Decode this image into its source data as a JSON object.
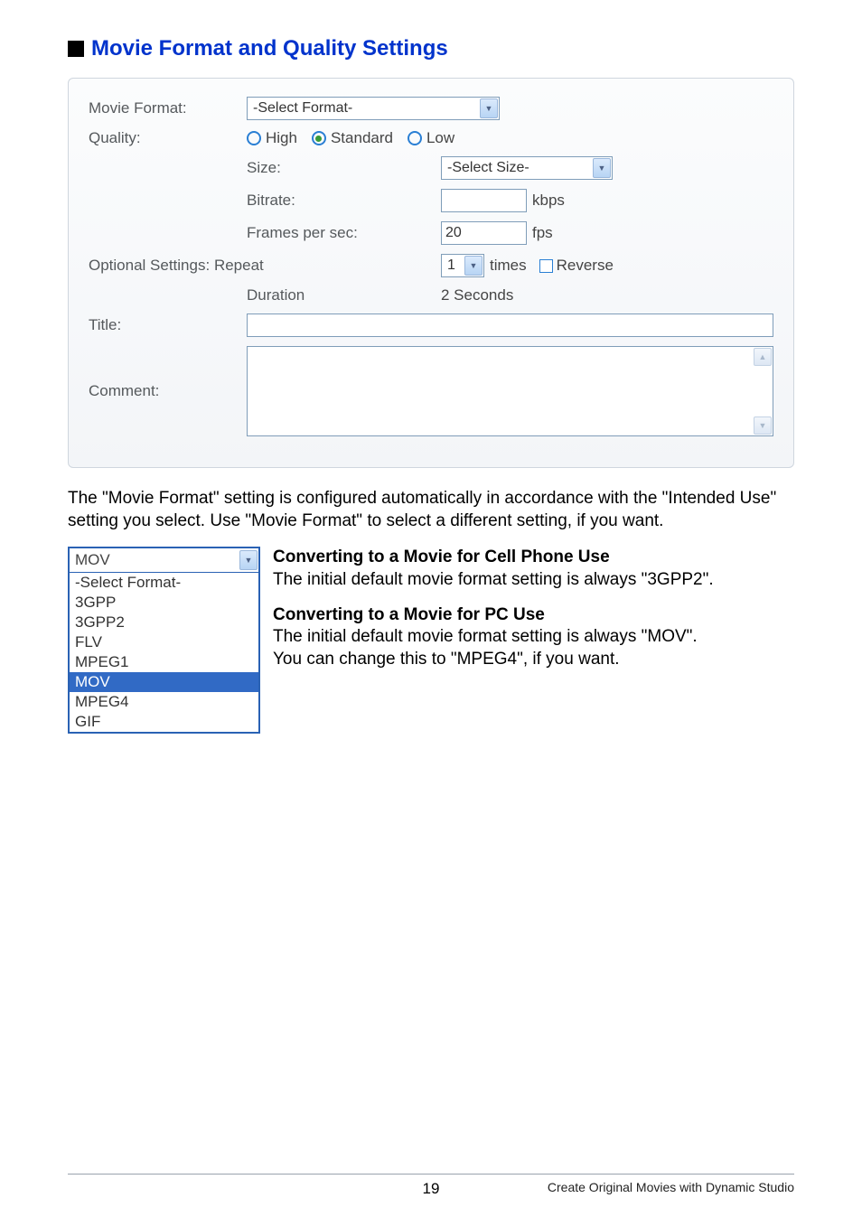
{
  "heading": "Movie Format and Quality Settings",
  "form": {
    "movie_format_label": "Movie Format:",
    "movie_format_value": "-Select Format-",
    "quality_label": "Quality:",
    "quality_options": {
      "high": "High",
      "standard": "Standard",
      "low": "Low"
    },
    "size_label": "Size:",
    "size_value": "-Select Size-",
    "bitrate_label": "Bitrate:",
    "bitrate_unit": "kbps",
    "fps_label": "Frames per sec:",
    "fps_value": "20",
    "fps_unit": "fps",
    "optional_label": "Optional Settings:",
    "repeat_label": "Repeat",
    "repeat_value": "1",
    "times_label": "times",
    "reverse_label": "Reverse",
    "duration_label": "Duration",
    "duration_value": "2 Seconds",
    "title_label": "Title:",
    "comment_label": "Comment:"
  },
  "para1": "The \"Movie Format\" setting is configured automatically in accordance with the \"Intended Use\" setting you select. Use \"Movie Format\" to select a different setting, if you want.",
  "dropdown": {
    "selected_display": "MOV",
    "items": [
      "-Select Format-",
      "3GPP",
      "3GPP2",
      "FLV",
      "MPEG1",
      "MOV",
      "MPEG4",
      "GIF"
    ],
    "highlight": "MOV"
  },
  "section1": {
    "title": "Converting to a Movie for Cell Phone Use",
    "text": "The initial default movie format setting is always \"3GPP2\"."
  },
  "section2": {
    "title": "Converting to a Movie for PC Use",
    "text1": "The initial default movie format setting is always \"MOV\".",
    "text2": "You can change this to \"MPEG4\", if you want."
  },
  "footer": {
    "page": "19",
    "text": "Create Original Movies with Dynamic Studio"
  }
}
